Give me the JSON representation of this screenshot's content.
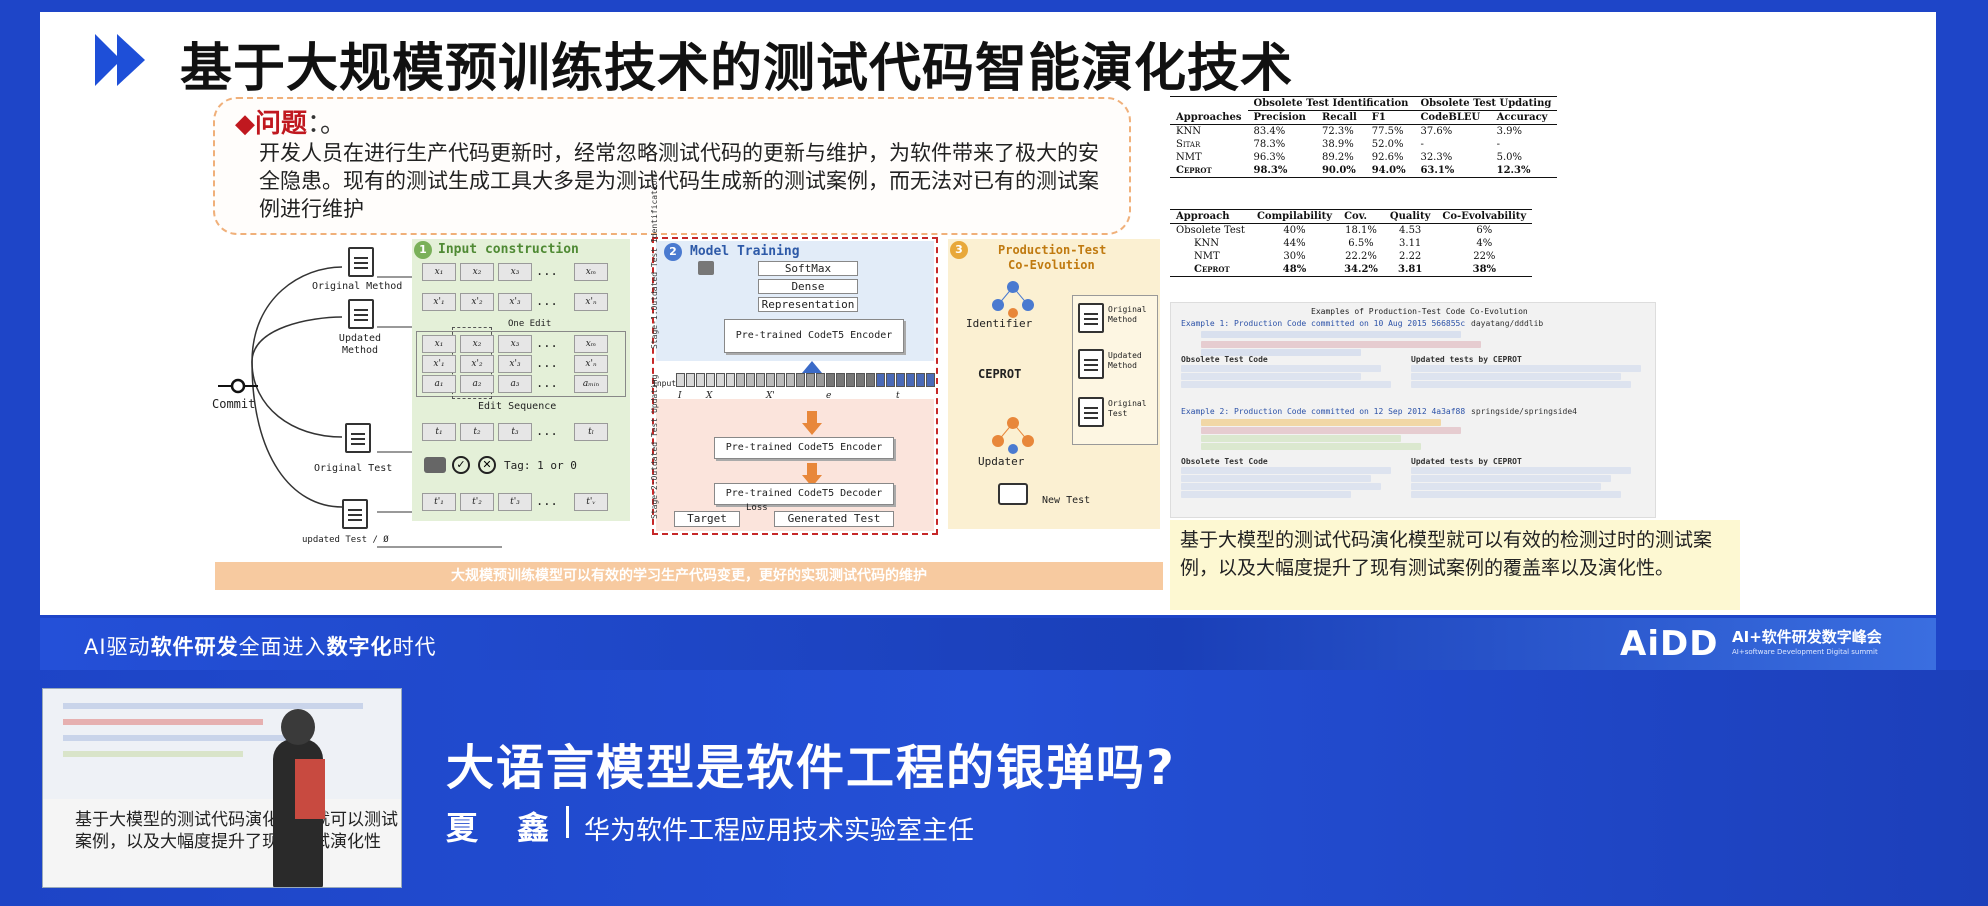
{
  "slide": {
    "title": "基于大规模预训练技术的测试代码智能演化技术",
    "problem": {
      "heading": "问题",
      "text": "开发人员在进行生产代码更新时，经常忽略测试代码的更新与维护，为软件带来了极大的安全隐患。现有的测试生成工具大多是为测试代码生成新的测试案例，而无法对已有的测试案例进行维护"
    },
    "diagram": {
      "left_labels": {
        "original_method": "Original Method",
        "updated_method": "Updated Method",
        "commit": "Commit",
        "original_test": "Original Test",
        "updated_test": "updated Test / Ø"
      },
      "stage1": {
        "num": "1",
        "title": "Input construction",
        "one_edit": "One Edit",
        "edit_sequence": "Edit Sequence",
        "tag": "Tag: 1 or 0",
        "row_x": [
          "x₁",
          "x₂",
          "x₃",
          "...",
          "xₘ"
        ],
        "row_xp": [
          "x'₁",
          "x'₂",
          "x'₃",
          "...",
          "x'ₙ"
        ],
        "seq_x": [
          "x₁",
          "x₂",
          "x₃",
          "...",
          "xₘ"
        ],
        "seq_xp": [
          "x'₁",
          "x'₂",
          "x'₃",
          "...",
          "x'ₙ"
        ],
        "seq_a": [
          "a₁",
          "a₂",
          "a₃",
          "...",
          "aₘᵢₙ"
        ],
        "row_t": [
          "t₁",
          "t₂",
          "t₃",
          "...",
          "tₗ"
        ],
        "row_tp": [
          "t'₁",
          "t'₂",
          "t'₃",
          "...",
          "t'ᵥ"
        ]
      },
      "stage2": {
        "num": "2",
        "title": "Model Training",
        "softmax": "SoftMax",
        "dense": "Dense",
        "representation": "Representation",
        "encoder1": "Pre-trained CodeT5 Encoder",
        "input_label": "Input",
        "input_symbols": [
          "I",
          "X",
          "X'",
          "e",
          "t"
        ],
        "encoder2": "Pre-trained CodeT5 Encoder",
        "decoder": "Pre-trained CodeT5 Decoder",
        "target": "Target",
        "loss": "Loss",
        "generated": "Generated Test",
        "stage1_side": "Stage-1:Outdated Test Identification",
        "stage2_side": "Stage-2:Outdated Test Updating"
      },
      "stage3": {
        "num": "3",
        "title_line1": "Production-Test",
        "title_line2": "Co-Evolution",
        "identifier": "Identifier",
        "ceprot": "CEPROT",
        "updater": "Updater",
        "new_test": "New Test",
        "original_method": "Original Method",
        "updated_method": "Updated Method",
        "original_test": "Original Test"
      }
    },
    "caption": "大规模预训练模型可以有效的学习生产代码变更，更好的实现测试代码的维护",
    "table1": {
      "group1": "Obsolete Test Identification",
      "group2": "Obsolete Test Updating",
      "headers": [
        "Approaches",
        "Precision",
        "Recall",
        "F1",
        "CodeBLEU",
        "Accuracy"
      ],
      "rows": [
        [
          "KNN",
          "83.4%",
          "72.3%",
          "77.5%",
          "37.6%",
          "3.9%"
        ],
        [
          "Sitar",
          "78.3%",
          "38.9%",
          "52.0%",
          "-",
          "-"
        ],
        [
          "NMT",
          "96.3%",
          "89.2%",
          "92.6%",
          "32.3%",
          "5.0%"
        ],
        [
          "Ceprot",
          "98.3%",
          "90.0%",
          "94.0%",
          "63.1%",
          "12.3%"
        ]
      ]
    },
    "table2": {
      "headers": [
        "Approach",
        "Compilability",
        "Cov.",
        "Quality",
        "Co-Evolvability"
      ],
      "rows": [
        [
          "Obsolete Test",
          "40%",
          "18.1%",
          "4.53",
          "6%"
        ],
        [
          "KNN",
          "44%",
          "6.5%",
          "3.11",
          "4%"
        ],
        [
          "NMT",
          "30%",
          "22.2%",
          "2.22",
          "22%"
        ],
        [
          "Ceprot",
          "48%",
          "34.2%",
          "3.81",
          "38%"
        ]
      ]
    },
    "examples": {
      "title": "Examples of Production-Test Code Co-Evolution",
      "ex1": "Example 1: Production Code committed on 10 Aug 2015 566855c",
      "ex1_repo": "dayatang/dddlib",
      "ex1_old": "Obsolete Test Code",
      "ex1_new": "Updated tests by CEPROT",
      "ex2": "Example 2: Production Code committed on 12 Sep 2012 4a3af88",
      "ex2_repo": "springside/springside4",
      "ex2_old": "Obsolete Test Code",
      "ex2_new": "Updated tests by CEPROT"
    },
    "summary": "基于大模型的测试代码演化模型就可以有效的检测过时的测试案例，以及大幅度提升了现有测试案例的覆盖率以及演化性。"
  },
  "banner": {
    "slogan_parts": [
      "AI驱动",
      "软件研发",
      "全面进入",
      "数字化",
      "时代"
    ],
    "logo_main": "AiDD",
    "logo_sup": "AI+软件研发数字峰会",
    "logo_sub": "AI+software Development Digital summit"
  },
  "camera": {
    "overlay_text": "基于大模型的测试代码演化模型就可以测试案例，以及大幅度提升了现有测试演化性"
  },
  "talk": {
    "title": "大语言模型是软件工程的银弹吗?",
    "speaker": "夏 鑫",
    "role": "华为软件工程应用技术实验室主任"
  },
  "colors": {
    "background_blue": "#1e45c8",
    "stage1_green": "#e4f0d8",
    "stage2_blue": "#e2ecf8",
    "stage3_yellow": "#fbf0d2",
    "problem_red": "#c0181f",
    "summary_bg": "#fdf8d2",
    "caption_bg": "#f7caa0"
  }
}
